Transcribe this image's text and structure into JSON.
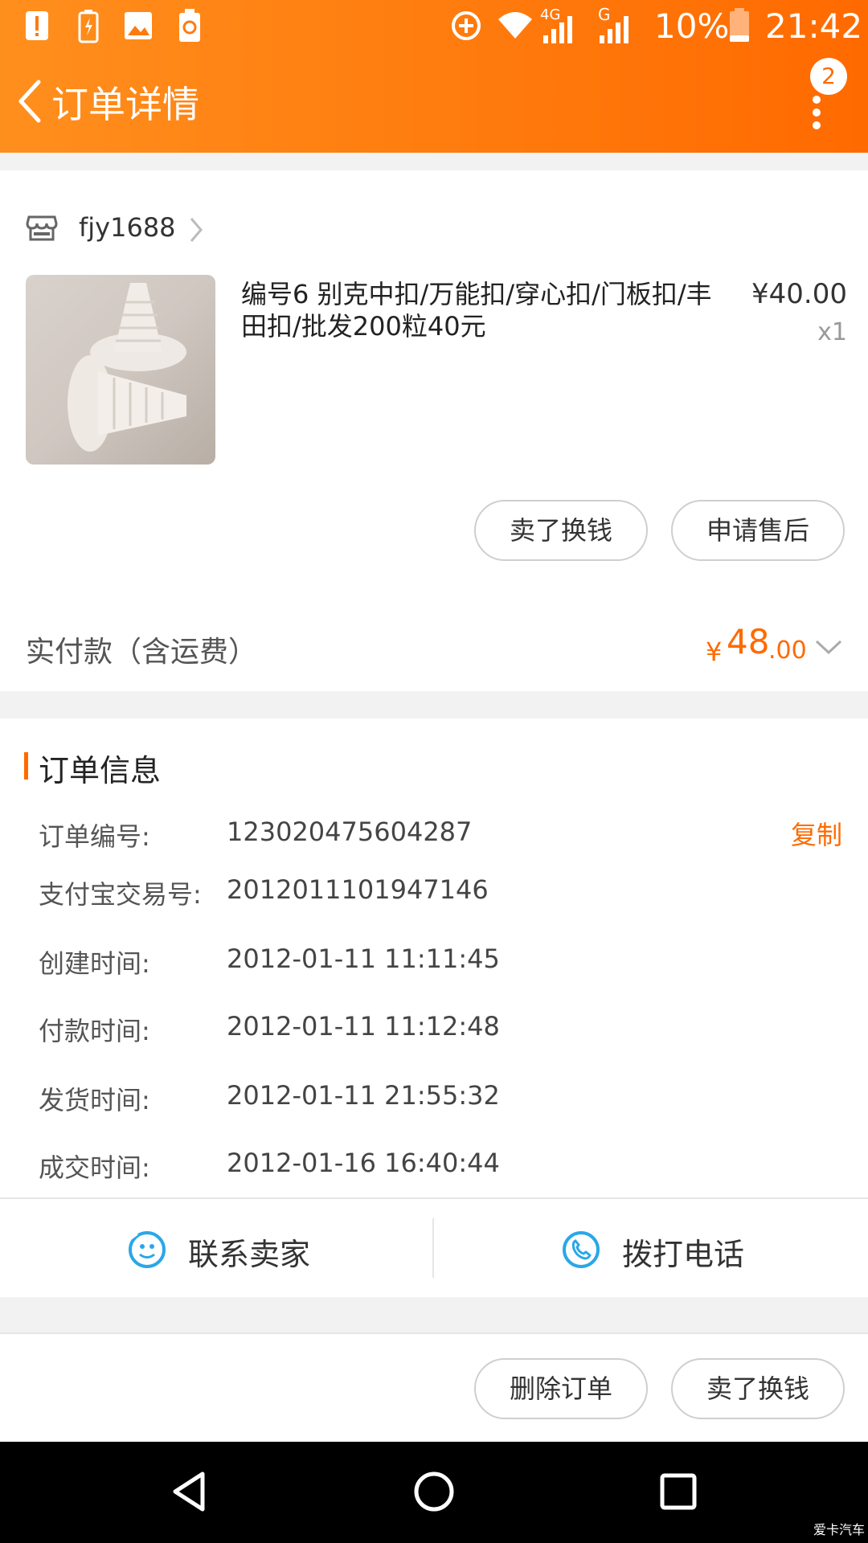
{
  "status_bar": {
    "battery_percent": "10%",
    "time": "21:42",
    "network_4g": "4G",
    "network_g": "G"
  },
  "header": {
    "title": "订单详情",
    "badge_count": "2"
  },
  "shop": {
    "name": "fjy1688"
  },
  "product": {
    "title": "编号6 别克中扣/万能扣/穿心扣/门板扣/丰田扣/批发200粒40元",
    "price": "¥40.00",
    "quantity": "x1"
  },
  "item_actions": {
    "sell_label": "卖了换钱",
    "after_sale_label": "申请售后"
  },
  "payment": {
    "label": "实付款（含运费）",
    "currency": "¥",
    "amount_int": "48",
    "amount_dec": ".00"
  },
  "order_info": {
    "section_title": "订单信息",
    "copy_label": "复制",
    "rows": [
      {
        "label": "订单编号:",
        "value": "123020475604287"
      },
      {
        "label": "支付宝交易号:",
        "value": "2012011101947146"
      },
      {
        "label": "创建时间:",
        "value": "2012-01-11 11:11:45"
      },
      {
        "label": "付款时间:",
        "value": "2012-01-11 11:12:48"
      },
      {
        "label": "发货时间:",
        "value": "2012-01-11 21:55:32"
      },
      {
        "label": "成交时间:",
        "value": "2012-01-16 16:40:44"
      }
    ]
  },
  "contact": {
    "seller_label": "联系卖家",
    "call_label": "拨打电话"
  },
  "footer_actions": {
    "delete_label": "删除订单",
    "sell_label": "卖了换钱"
  },
  "watermark": "爱卡汽车",
  "colors": {
    "accent": "#ff6a00",
    "header_start": "#ff8f1d",
    "contact_icon": "#2aa7e8"
  }
}
